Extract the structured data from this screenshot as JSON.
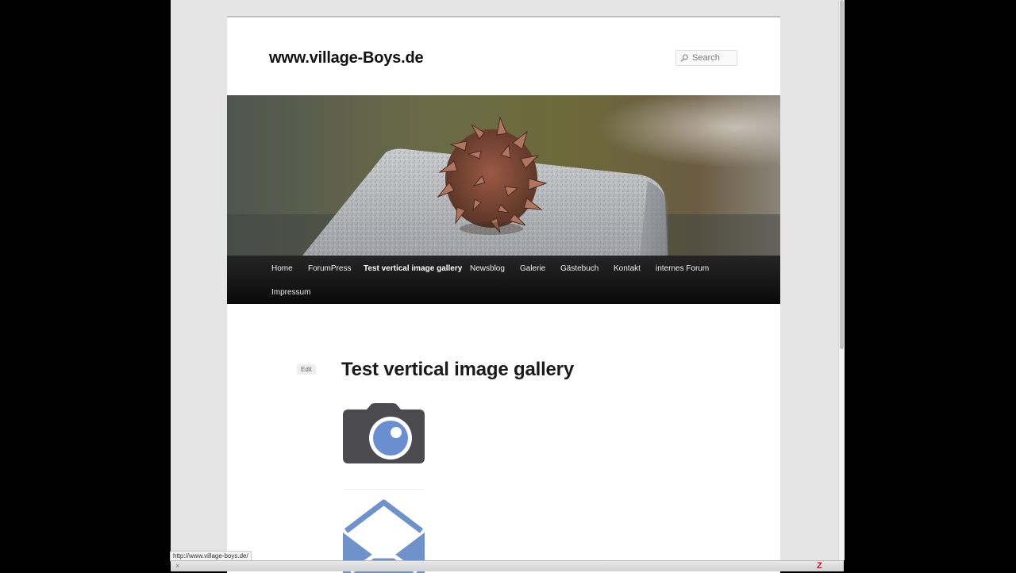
{
  "site": {
    "title": "www.village-Boys.de",
    "search_placeholder": "Search"
  },
  "nav": {
    "items": [
      {
        "label": "Home",
        "current": false
      },
      {
        "label": "ForumPress",
        "current": false
      },
      {
        "label": "Test vertical image gallery",
        "current": true
      },
      {
        "label": "Newsblog",
        "current": false
      },
      {
        "label": "Galerie",
        "current": false
      },
      {
        "label": "Gästebuch",
        "current": false
      },
      {
        "label": "Kontakt",
        "current": false
      },
      {
        "label": "internes Forum",
        "current": false
      },
      {
        "label": "Impressum",
        "current": false
      }
    ]
  },
  "entry": {
    "edit_label": "Edit",
    "title": "Test vertical image gallery",
    "gallery": [
      {
        "icon": "camera-icon"
      },
      {
        "icon": "mail-icon"
      }
    ]
  },
  "statusbar": {
    "url": "http://www.village-boys.de/",
    "close_glyph": "×",
    "addon_glyph": "Z"
  },
  "colors": {
    "nav_bg": "#111111",
    "camera_body": "#4a4a4f",
    "camera_lens": "#6a8fd0",
    "mail_blue": "#6d92cc"
  }
}
